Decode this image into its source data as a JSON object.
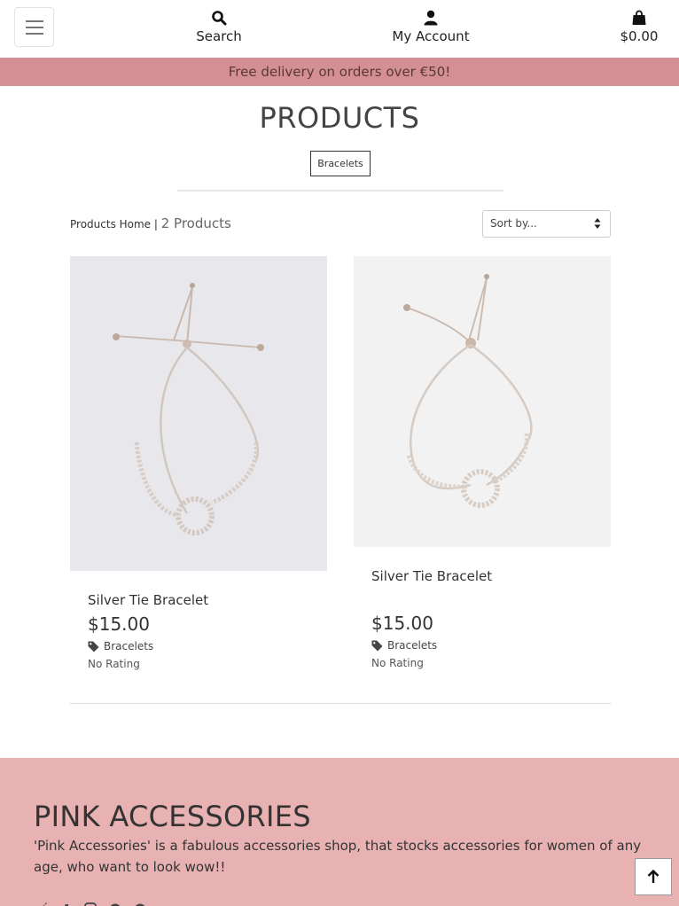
{
  "header": {
    "menu_icon": "hamburger-icon",
    "search": {
      "label": "Search",
      "icon": "search-icon"
    },
    "account": {
      "label": "My Account",
      "icon": "user-icon"
    },
    "bag": {
      "label": "$0.00",
      "icon": "shopping-bag-icon"
    }
  },
  "banner": {
    "text": "Free delivery on orders over €50!",
    "color": "#d38f93"
  },
  "main": {
    "title": "PRODUCTS",
    "category_badge": "Bracelets",
    "breadcrumb_link": "Products Home",
    "breadcrumb_sep": " | ",
    "count": "2 Products",
    "sort": {
      "value": "Sort by..."
    }
  },
  "products": [
    {
      "name": "Silver Tie Bracelet",
      "price": "$15.00",
      "category": "Bracelets",
      "rating": "No Rating"
    },
    {
      "name": "Silver Tie Bracelet",
      "price": "$15.00",
      "category": "Bracelets",
      "rating": "No Rating"
    }
  ],
  "footer": {
    "brand": "PINK ACCESSORIES",
    "about": "'Pink Accessories' is a fabulous accessories shop, that stocks accessories for women of any age, who want to look wow!!",
    "social_icons": [
      "twitter-icon",
      "facebook-icon",
      "instagram-icon",
      "pinterest-icon",
      "pinterest-icon"
    ],
    "background": "#e8b2b3"
  }
}
